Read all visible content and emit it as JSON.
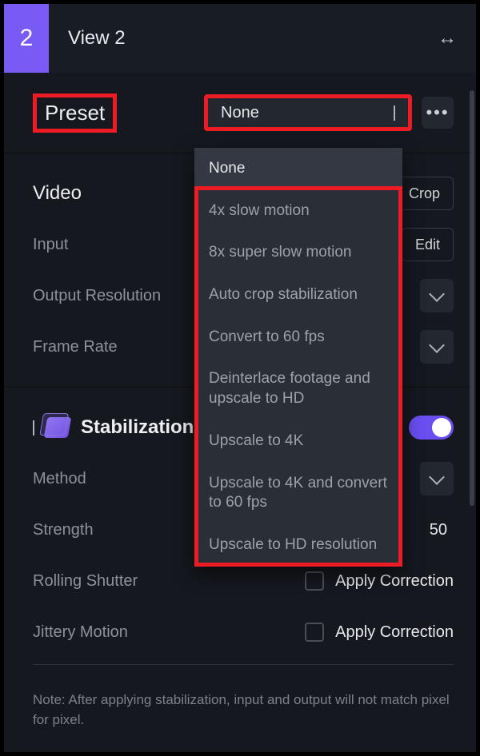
{
  "header": {
    "badge": "2",
    "title": "View 2"
  },
  "preset": {
    "label": "Preset",
    "selected": "None",
    "options": [
      "None",
      "4x slow motion",
      "8x super slow motion",
      "Auto crop stabilization",
      "Convert to 60 fps",
      "Deinterlace footage and upscale to HD",
      "Upscale to 4K",
      "Upscale to 4K and convert to 60 fps",
      "Upscale to HD resolution"
    ]
  },
  "video": {
    "heading": "Video",
    "crop_btn": "Crop",
    "input_label": "Input",
    "edit_btn": "Edit",
    "output_res_label": "Output Resolution",
    "frame_rate_label": "Frame Rate"
  },
  "stabilization": {
    "heading": "Stabilization",
    "enabled": true,
    "method_label": "Method",
    "strength_label": "Strength",
    "strength_value": "50",
    "rolling_shutter_label": "Rolling Shutter",
    "jittery_motion_label": "Jittery Motion",
    "apply_correction_label": "Apply Correction",
    "note": "Note: After applying stabilization, input and output will not match pixel for pixel."
  }
}
